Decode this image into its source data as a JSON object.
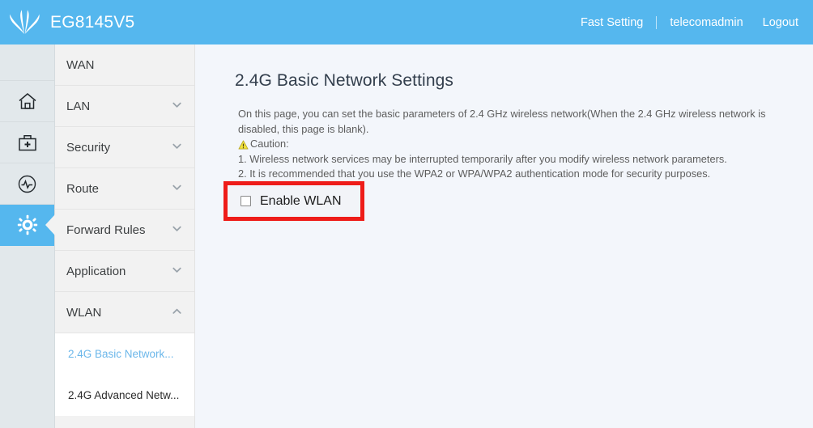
{
  "header": {
    "brand_model": "EG8145V5",
    "logo_icon": "huawei-flower-logo",
    "fast_setting": "Fast Setting",
    "username": "telecomadmin",
    "logout": "Logout",
    "background_color": "#55b7ee"
  },
  "icon_rail": {
    "items": [
      {
        "icon": "home-icon",
        "name": "home",
        "active": false
      },
      {
        "icon": "toolbox-icon",
        "name": "toolbox",
        "active": false
      },
      {
        "icon": "diagnose-icon",
        "name": "diagnose",
        "active": false
      },
      {
        "icon": "gear-icon",
        "name": "settings",
        "active": true
      }
    ],
    "active_color": "#55b7ee"
  },
  "menu": {
    "items": [
      {
        "label": "WAN",
        "chevron": "none"
      },
      {
        "label": "LAN",
        "chevron": "down"
      },
      {
        "label": "Security",
        "chevron": "down"
      },
      {
        "label": "Route",
        "chevron": "down"
      },
      {
        "label": "Forward Rules",
        "chevron": "down"
      },
      {
        "label": "Application",
        "chevron": "down"
      },
      {
        "label": "WLAN",
        "chevron": "up"
      }
    ],
    "submenu": [
      {
        "label": "2.4G Basic Network...",
        "active": true
      },
      {
        "label": "2.4G Advanced Netw...",
        "active": false
      }
    ],
    "active_link_color": "#6cb7ea"
  },
  "main": {
    "title": "2.4G Basic Network Settings",
    "description_line1": "On this page, you can set the basic parameters of 2.4 GHz wireless network(When the 2.4 GHz wireless network is",
    "description_line2": "disabled, this page is blank).",
    "caution_label": "Caution:",
    "caution_icon": "warning-triangle-icon",
    "caution_items": [
      "1. Wireless network services may be interrupted temporarily after you modify wireless network parameters.",
      "2. It is recommended that you use the WPA2 or WPA/WPA2 authentication mode for security purposes."
    ],
    "enable_wlan": {
      "label": "Enable WLAN",
      "checked": false,
      "highlight_color": "#ee1c19"
    }
  }
}
